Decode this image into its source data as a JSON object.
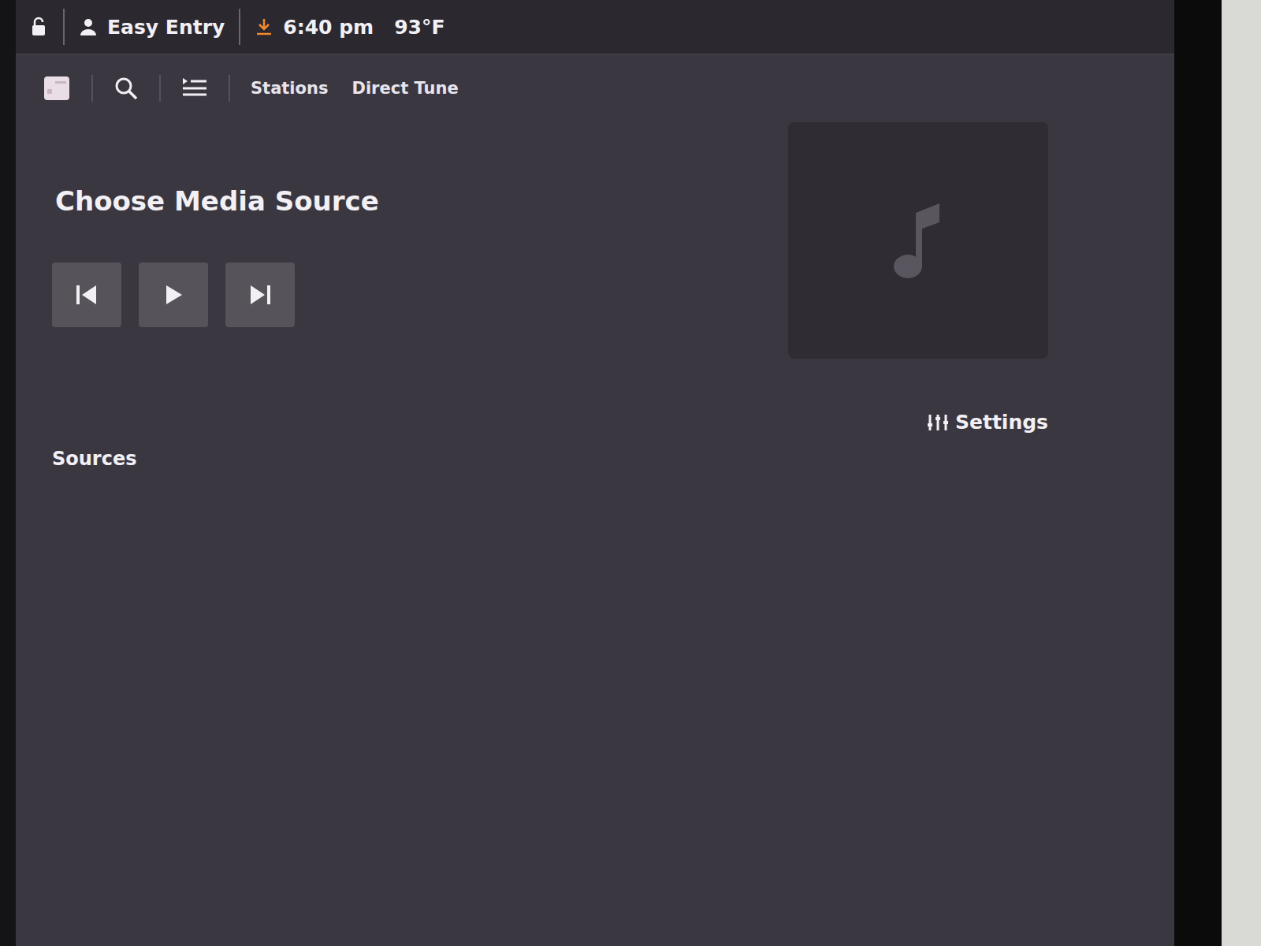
{
  "status_bar": {
    "locked": false,
    "profile": "Easy Entry",
    "downloading": true,
    "time": "6:40 pm",
    "temperature": "93°F"
  },
  "toolbar": {
    "tabs": [
      {
        "label": "Stations",
        "selected": false
      },
      {
        "label": "Direct Tune",
        "selected": false
      }
    ]
  },
  "media": {
    "title": "Choose Media Source",
    "playing": false,
    "settings": "Settings"
  },
  "sources": {
    "heading": "Sources"
  }
}
